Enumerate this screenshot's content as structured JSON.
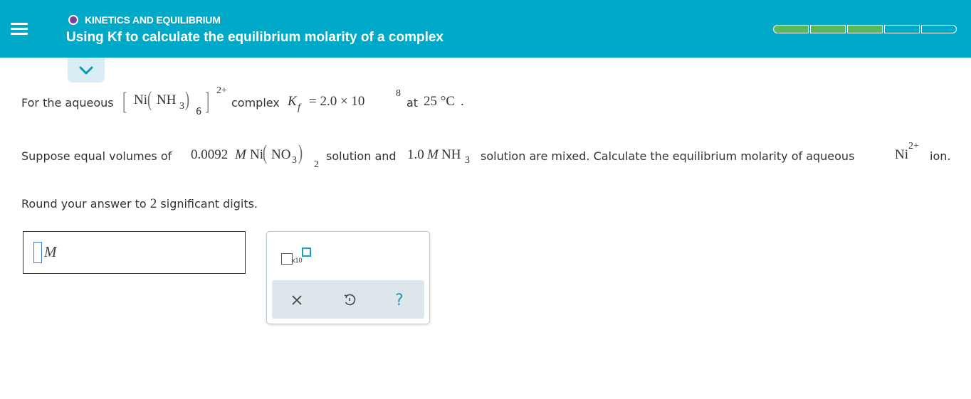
{
  "header": {
    "topic": "KINETICS AND EQUILIBRIUM",
    "title": "Using Kf to calculate the equilibrium molarity of a complex",
    "progress": {
      "completed": 3,
      "total": 5
    },
    "colors": {
      "bar": "#00a9c7",
      "topic_dot": "#7a3e9d",
      "progress_done": "#5cb85c"
    },
    "icons": [
      "menu-icon",
      "chevron-down-icon"
    ]
  },
  "question": {
    "line1": {
      "prefix": "For the aqueous",
      "bracket_left": "[",
      "ni": "Ni",
      "paren_left": "(",
      "nh": "NH",
      "nh_sub": "3",
      "paren_right": ")",
      "paren_sub": "6",
      "bracket_right": "]",
      "charge": "2+",
      "mid": "complex",
      "k": "K",
      "k_sub": "f",
      "k_value": "= 2.0 × 10",
      "k_exp": "8",
      "at_label": "at",
      "temperature": "25 °C",
      "period": "."
    },
    "line2": {
      "prefix": "Suppose equal volumes of",
      "conc1": "0.0092",
      "unit1": "M",
      "ni": "Ni",
      "paren_left": "(",
      "no": "NO",
      "no_sub": "3",
      "paren_right": ")",
      "paren_sub": "2",
      "mid1": "solution and",
      "conc2": "1.0",
      "unit2": "M",
      "nh": "NH",
      "nh_sub": "3",
      "mid2": "solution are mixed. Calculate the equilibrium molarity of aqueous",
      "ion": "Ni",
      "ion_charge": "2+",
      "suffix": "ion."
    },
    "line3": {
      "prefix": "Round your answer to",
      "digits": "2",
      "suffix": "significant digits."
    }
  },
  "answer": {
    "value": "",
    "unit": "M"
  },
  "palette": {
    "sci_label": "x10",
    "icons": [
      "scientific-notation-icon",
      "clear-icon",
      "undo-icon",
      "help-icon"
    ],
    "help_glyph": "?"
  }
}
